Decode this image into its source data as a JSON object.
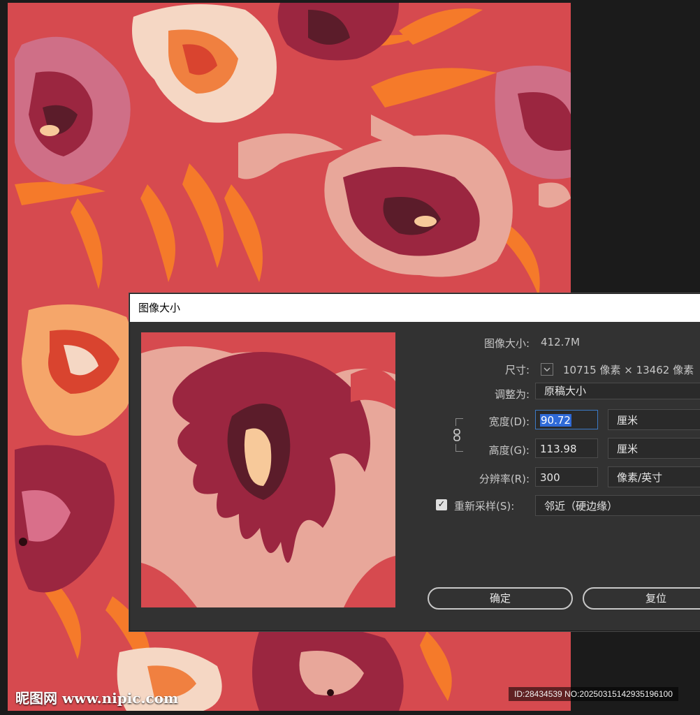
{
  "dialog": {
    "title": "图像大小",
    "image_size_label": "图像大小:",
    "image_size_value": "412.7M",
    "dimensions_label": "尺寸:",
    "dimensions_value": "10715 像素  ×  13462 像素",
    "fit_to_label": "调整为:",
    "fit_to_value": "原稿大小",
    "width_label": "宽度(D):",
    "width_value": "90.72",
    "width_unit": "厘米",
    "height_label": "高度(G):",
    "height_value": "113.98",
    "height_unit": "厘米",
    "resolution_label": "分辨率(R):",
    "resolution_value": "300",
    "resolution_unit": "像素/英寸",
    "resample_label": "重新采样(S):",
    "resample_checked": true,
    "resample_value": "邻近（硬边缘）",
    "ok_label": "确定",
    "reset_label": "复位"
  },
  "watermark": {
    "site": "昵图网 www.nipic.com",
    "id_text": "ID:28434539 NO:20250315142935196100"
  },
  "colors": {
    "pattern_bg": "#d64a4f",
    "petal_pink": "#e8a79a",
    "flower_dark": "#9b2640",
    "leaf_orange": "#f57a2a",
    "dialog_bg": "#323232",
    "field_bg": "#2a2a2a",
    "selection_blue": "#2f6ad8"
  }
}
